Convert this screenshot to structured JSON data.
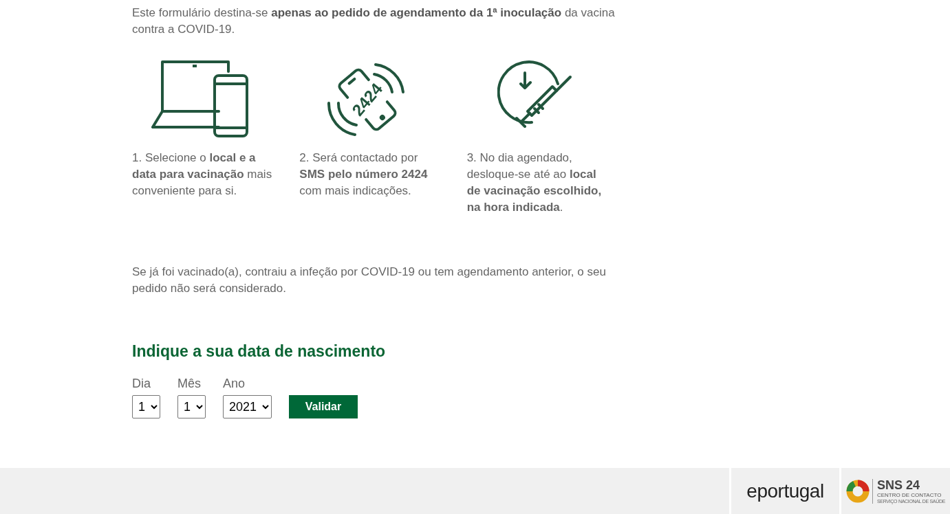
{
  "intro": "Este formulário destina-se **apenas ao pedido de agendamento da 1ª inoculação** da vacina contra a COVID-19.",
  "steps": [
    {
      "kind": "devices",
      "text": "1. Selecione o **local e a data para vacinação** mais conveniente para si."
    },
    {
      "kind": "phone",
      "icon_text": "2424",
      "text": "2. Será contactado por **SMS pelo número 2424** com mais indicações."
    },
    {
      "kind": "vaccine",
      "text": "3. No dia agendado, desloque-se até ao **local de vacinação escolhido, na hora indicada**."
    }
  ],
  "notice": "Se já foi vacinado(a), contraiu a infeção por COVID-19 ou tem agendamento anterior, o seu pedido não será considerado.",
  "form": {
    "heading": "Indique a sua data de nascimento",
    "fields": [
      {
        "label": "Dia",
        "value": "1"
      },
      {
        "label": "Mês",
        "value": "1"
      },
      {
        "label": "Ano",
        "value": "2021"
      }
    ],
    "submit": "Validar"
  },
  "footer": {
    "eportugal": "eportugal",
    "sns": {
      "title": "SNS 24",
      "subtitle": "CENTRO DE CONTACTO",
      "tagline": "SERVIÇO NACIONAL DE SAÚDE"
    }
  }
}
